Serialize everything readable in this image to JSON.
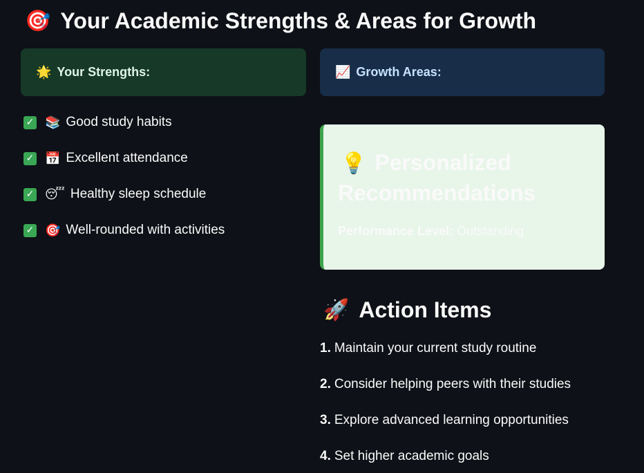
{
  "header": {
    "icon": "target-emoji-icon",
    "icon_glyph": "🎯",
    "title": "Your Academic Strengths & Areas for Growth"
  },
  "strengths_card": {
    "icon": "glowing-star-icon",
    "icon_glyph": "🌟",
    "label": "Your Strengths:",
    "bg_color": "#173928"
  },
  "growth_card": {
    "icon": "chart-increasing-icon",
    "icon_glyph": "📈",
    "label": "Growth Areas:",
    "bg_color": "#172d48"
  },
  "strengths": [
    {
      "check": "✓",
      "icon": "books-icon",
      "icon_glyph": "📚",
      "text": "Good study habits"
    },
    {
      "check": "✓",
      "icon": "calendar-icon",
      "icon_glyph": "📅",
      "text": "Excellent attendance"
    },
    {
      "check": "✓",
      "icon": "sleeping-face-icon",
      "icon_glyph": "😴",
      "text": "Healthy sleep schedule"
    },
    {
      "check": "✓",
      "icon": "target-icon",
      "icon_glyph": "🎯",
      "text": "Well-rounded with activities"
    }
  ],
  "recommendations": {
    "icon": "light-bulb-icon",
    "icon_glyph": "💡",
    "title": "Personalized Recommendations",
    "level_label": "Performance Level:",
    "level_value": "Outstanding",
    "bg_color": "#e8f5e9",
    "accent_color": "#3fa34d"
  },
  "action_items": {
    "icon": "rocket-icon",
    "icon_glyph": "🚀",
    "title": "Action Items",
    "items": [
      {
        "num": "1.",
        "text": "Maintain your current study routine"
      },
      {
        "num": "2.",
        "text": "Consider helping peers with their studies"
      },
      {
        "num": "3.",
        "text": "Explore advanced learning opportunities"
      },
      {
        "num": "4.",
        "text": "Set higher academic goals"
      }
    ]
  }
}
